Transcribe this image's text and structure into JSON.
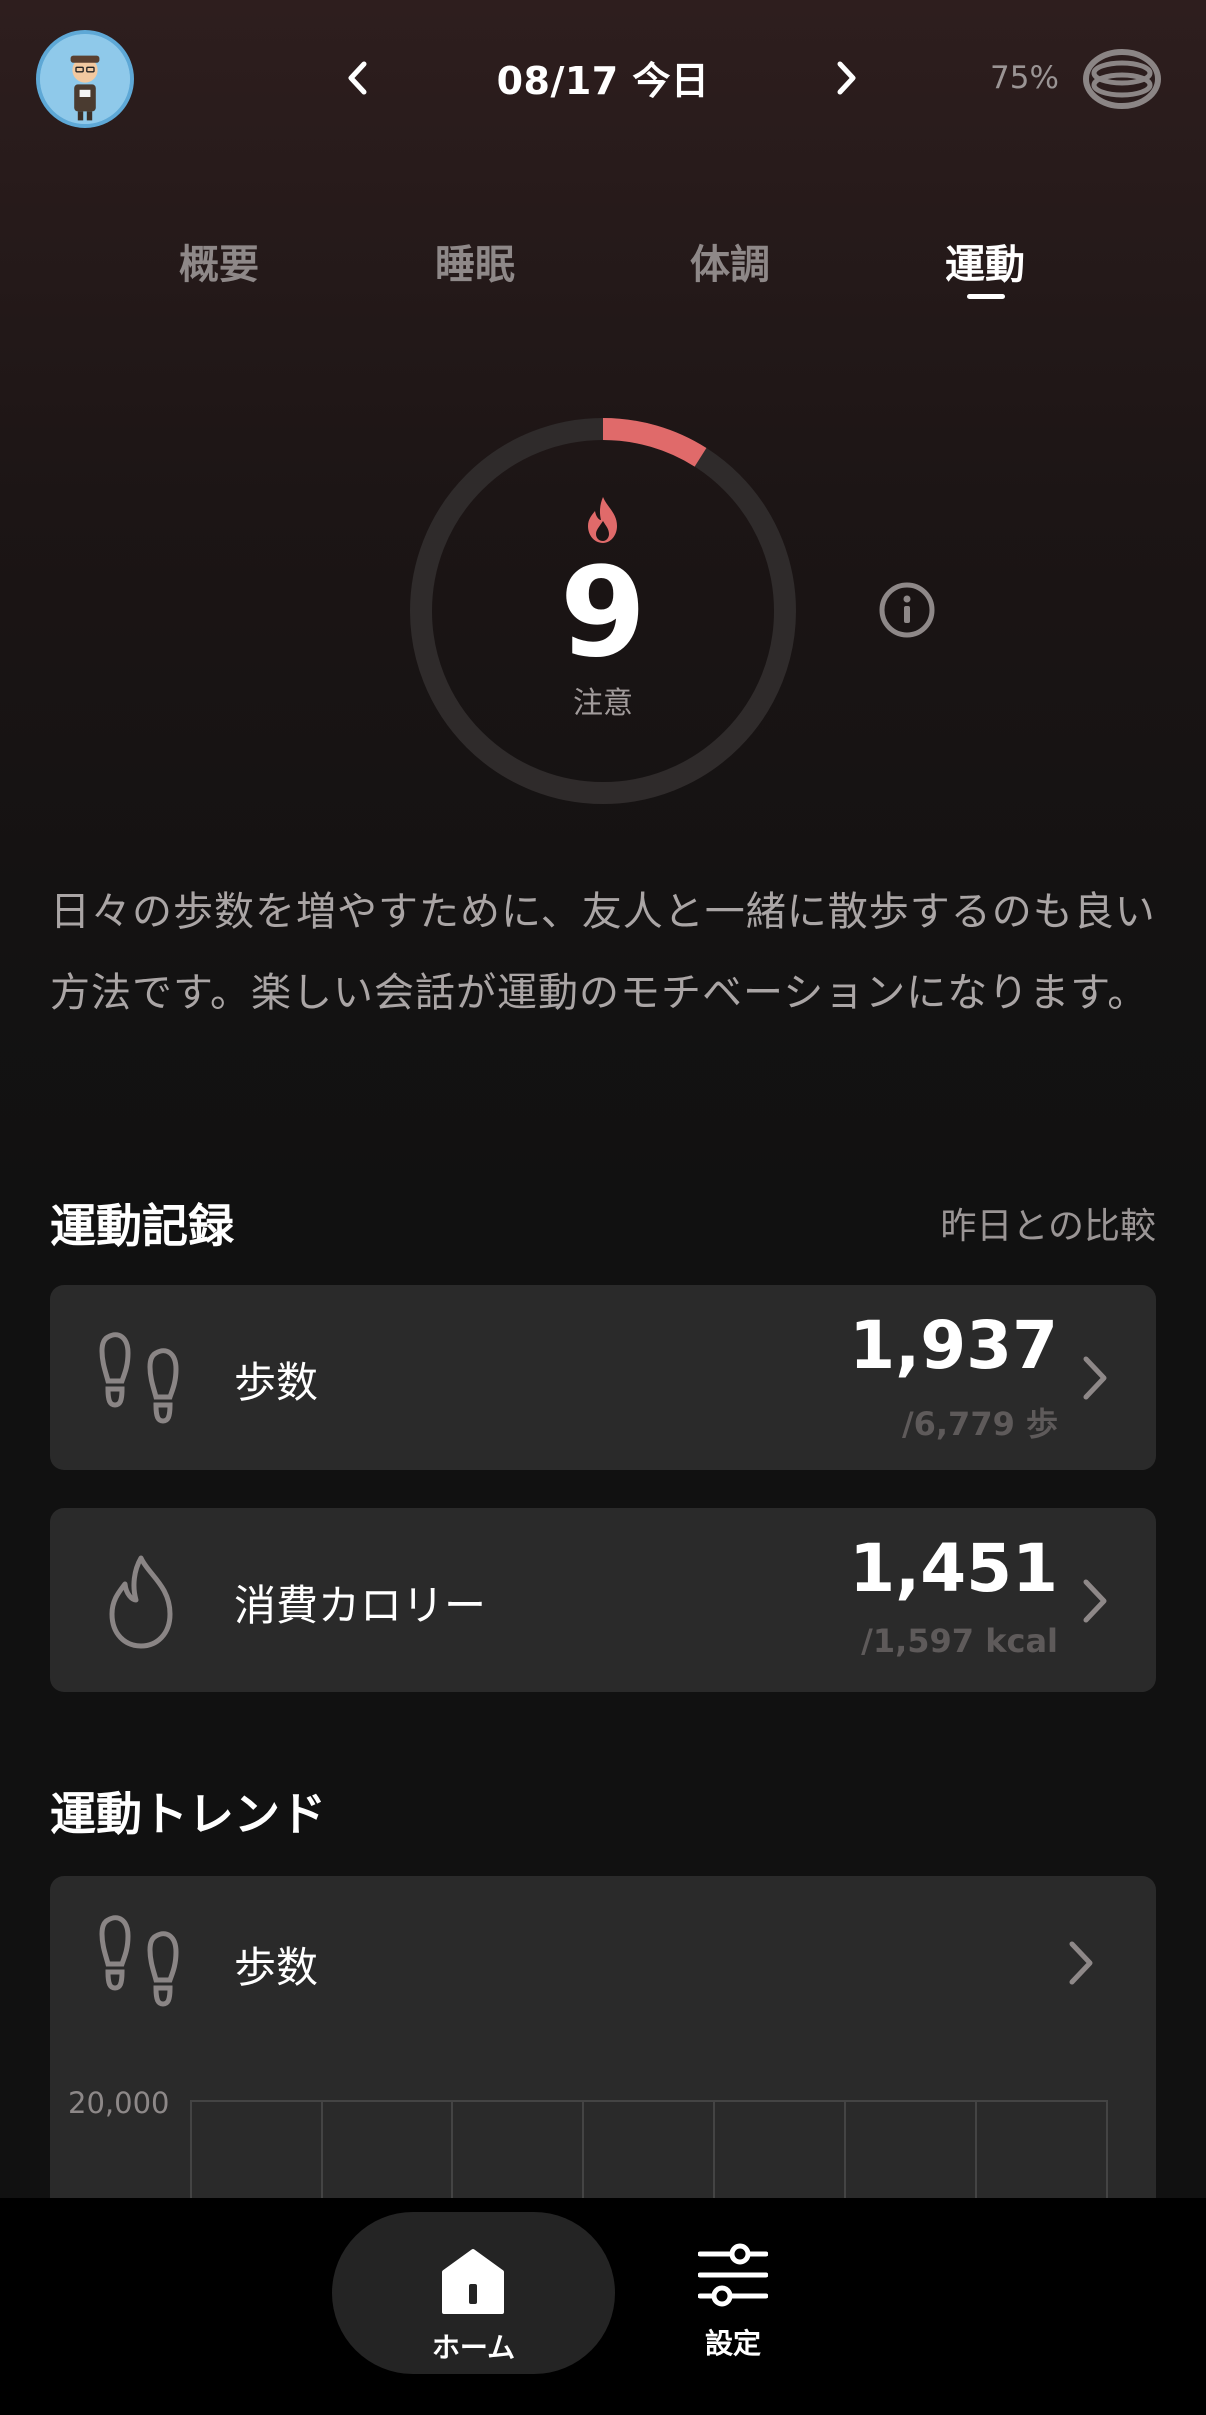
{
  "header": {
    "date_title": "08/17 今日",
    "battery": "75%"
  },
  "tabs": [
    {
      "label": "概要"
    },
    {
      "label": "睡眠"
    },
    {
      "label": "体調"
    },
    {
      "label": "運動",
      "active": true
    }
  ],
  "score": {
    "value": "9",
    "label": "注意",
    "progress_fraction": 0.09,
    "accent_color": "#e06a6a"
  },
  "advice_text": "日々の歩数を増やすために、友人と一緒に散歩するのも良い方法です。楽しい会話が運動のモチベーションになります。",
  "activity_record": {
    "title": "運動記録",
    "compare_link": "昨日との比較",
    "cards": [
      {
        "icon": "footprints-icon",
        "label": "歩数",
        "value": "1,937",
        "sub": "/6,779 歩"
      },
      {
        "icon": "flame-icon",
        "label": "消費カロリー",
        "value": "1,451",
        "sub": "/1,597 kcal"
      }
    ]
  },
  "trend": {
    "title": "運動トレンド",
    "card_label": "歩数",
    "y_axis_top_label": "20,000"
  },
  "bottom_nav": {
    "home": "ホーム",
    "settings": "設定"
  }
}
